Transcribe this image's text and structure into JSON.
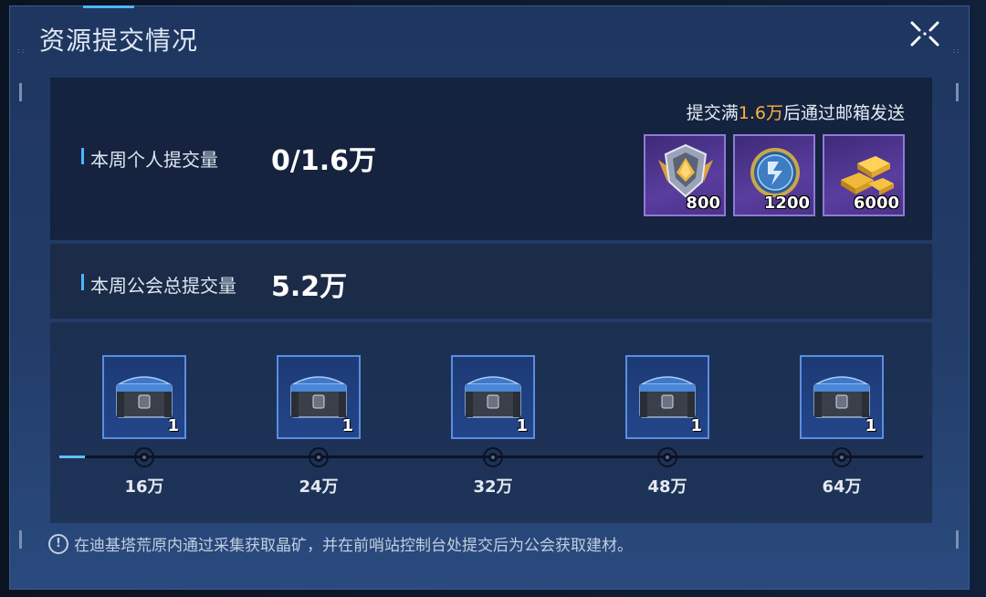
{
  "dialog": {
    "title": "资源提交情况"
  },
  "personal": {
    "label": "本周个人提交量",
    "value": "0/1.6万"
  },
  "notice": {
    "prefix": "提交满",
    "amount": "1.6万",
    "suffix": "后通过邮箱发送"
  },
  "rewards": [
    {
      "icon": "gold-shield-badge-icon",
      "qty": "800"
    },
    {
      "icon": "blue-coin-icon",
      "qty": "1200"
    },
    {
      "icon": "gold-bars-icon",
      "qty": "6000"
    }
  ],
  "guild": {
    "label": "本周公会总提交量",
    "value": "5.2万"
  },
  "progress": {
    "fill_fraction": 0.03,
    "milestones": [
      {
        "label": "16万",
        "chest_qty": "1"
      },
      {
        "label": "24万",
        "chest_qty": "1"
      },
      {
        "label": "32万",
        "chest_qty": "1"
      },
      {
        "label": "48万",
        "chest_qty": "1"
      },
      {
        "label": "64万",
        "chest_qty": "1"
      }
    ]
  },
  "footer": {
    "info_icon": "!",
    "text": "在迪基塔荒原内通过采集获取晶矿，并在前哨站控制台处提交后为公会获取建材。"
  },
  "colors": {
    "accent_blue": "#4fb6ff",
    "highlight_orange": "#ffb13b",
    "reward_purple": "#5a3d9e"
  }
}
